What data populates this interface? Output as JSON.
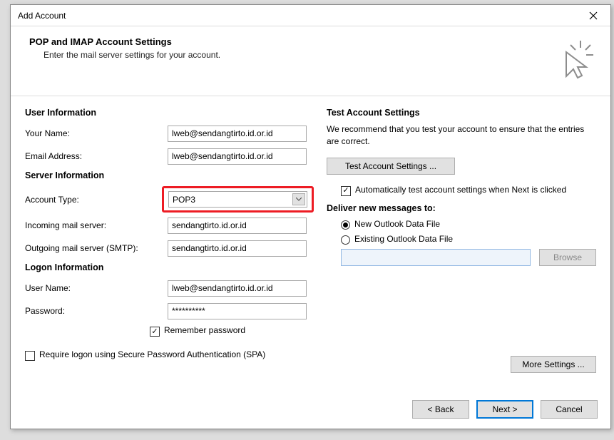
{
  "window": {
    "title": "Add Account"
  },
  "header": {
    "title": "POP and IMAP Account Settings",
    "subtitle": "Enter the mail server settings for your account."
  },
  "left": {
    "user_info_h": "User Information",
    "your_name_lbl": "Your Name:",
    "your_name_val": "lweb@sendangtirto.id.or.id",
    "email_lbl": "Email Address:",
    "email_val": "lweb@sendangtirto.id.or.id",
    "server_info_h": "Server Information",
    "acct_type_lbl": "Account Type:",
    "acct_type_val": "POP3",
    "incoming_lbl": "Incoming mail server:",
    "incoming_val": "sendangtirto.id.or.id",
    "outgoing_lbl": "Outgoing mail server (SMTP):",
    "outgoing_val": "sendangtirto.id.or.id",
    "logon_info_h": "Logon Information",
    "username_lbl": "User Name:",
    "username_val": "lweb@sendangtirto.id.or.id",
    "password_lbl": "Password:",
    "password_val": "**********",
    "remember_pw": "Remember password",
    "require_spa": "Require logon using Secure Password Authentication (SPA)"
  },
  "right": {
    "test_h": "Test Account Settings",
    "test_desc": "We recommend that you test your account to ensure that the entries are correct.",
    "test_btn": "Test Account Settings ...",
    "auto_test": "Automatically test account settings when Next is clicked",
    "deliver_h": "Deliver new messages to:",
    "new_file": "New Outlook Data File",
    "existing_file": "Existing Outlook Data File",
    "browse": "Browse",
    "more_settings": "More Settings ..."
  },
  "footer": {
    "back": "< Back",
    "next": "Next >",
    "cancel": "Cancel"
  }
}
